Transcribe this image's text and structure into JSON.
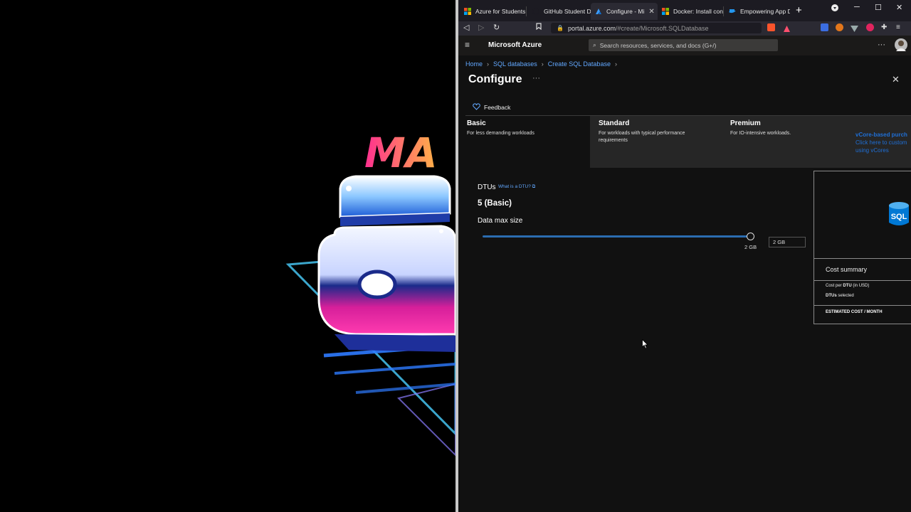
{
  "browser": {
    "tabs": [
      {
        "label": "Azure for Students",
        "active": false
      },
      {
        "label": "GitHub Student Da",
        "active": false
      },
      {
        "label": "Configure - Mi",
        "active": true
      },
      {
        "label": "Docker: Install cont",
        "active": false
      },
      {
        "label": "Empowering App D",
        "active": false
      }
    ],
    "url_host": "portal.azure.com",
    "url_path": "/#create/Microsoft.SQLDatabase"
  },
  "azure": {
    "brand": "Microsoft Azure",
    "search_placeholder": "Search resources, services, and docs (G+/)"
  },
  "breadcrumb": [
    "Home",
    "SQL databases",
    "Create SQL Database"
  ],
  "page": {
    "title": "Configure",
    "more": "···",
    "feedback": "Feedback"
  },
  "tiers": [
    {
      "name": "Basic",
      "desc": "For less demanding workloads",
      "selected": true
    },
    {
      "name": "Standard",
      "desc": "For workloads with typical performance requirements",
      "selected": false
    },
    {
      "name": "Premium",
      "desc": "For IO-intensive workloads.",
      "selected": false
    }
  ],
  "vcore": {
    "heading": "vCore-based purch",
    "line1": "Click here to custom",
    "line2": "using vCores"
  },
  "dtu": {
    "label": "DTUs",
    "link": "What is a DTU? ⧉",
    "value": "5 (Basic)"
  },
  "datasize": {
    "label": "Data max size",
    "slider_max": "2 GB",
    "input_value": "2 GB",
    "slider_fraction": 1.0
  },
  "cost": {
    "sql_badge": "SQL",
    "title": "Cost summary",
    "row1_a": "Cost per ",
    "row1_b": "DTU",
    "row1_c": " (in USD)",
    "row2_a": "DTUs",
    "row2_b": " selected",
    "estimated": "ESTIMATED COST / MONTH"
  },
  "artwork": {
    "text": "MA"
  },
  "colors": {
    "link": "#62a8ff",
    "slider": "#2b6cb0",
    "azure_bar": "#1b1a19"
  }
}
